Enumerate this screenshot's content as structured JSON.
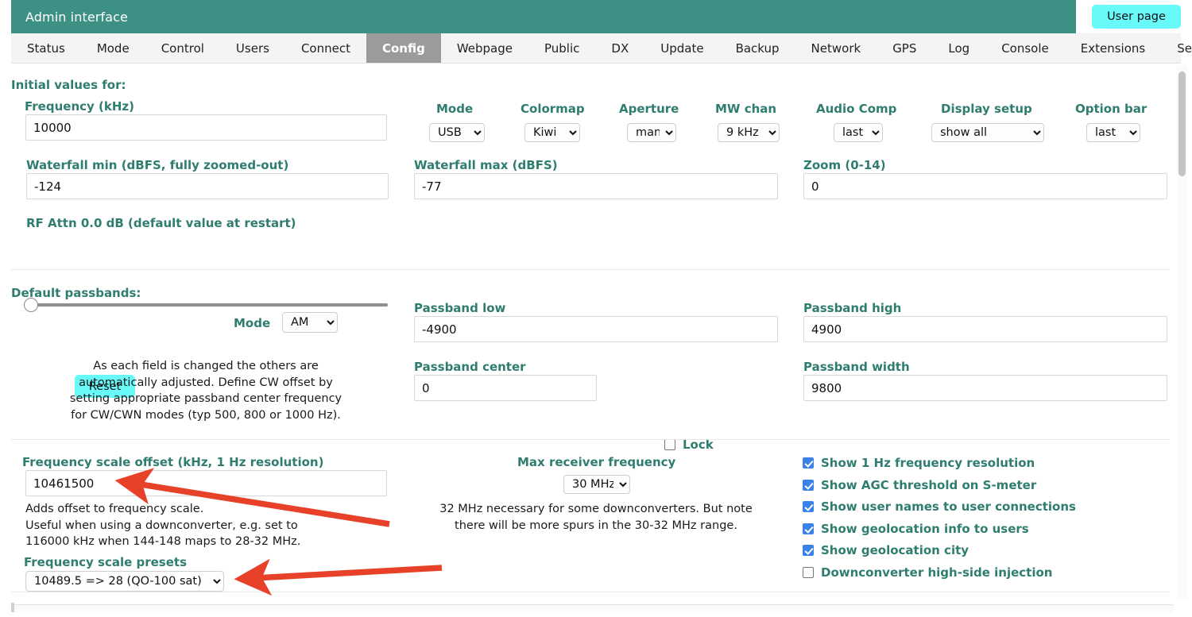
{
  "titlebar": {
    "title": "Admin interface",
    "user_page_button": "User page"
  },
  "tabs": [
    {
      "label": "Status",
      "active": false
    },
    {
      "label": "Mode",
      "active": false
    },
    {
      "label": "Control",
      "active": false
    },
    {
      "label": "Users",
      "active": false
    },
    {
      "label": "Connect",
      "active": false
    },
    {
      "label": "Config",
      "active": true
    },
    {
      "label": "Webpage",
      "active": false
    },
    {
      "label": "Public",
      "active": false
    },
    {
      "label": "DX",
      "active": false
    },
    {
      "label": "Update",
      "active": false
    },
    {
      "label": "Backup",
      "active": false
    },
    {
      "label": "Network",
      "active": false
    },
    {
      "label": "GPS",
      "active": false
    },
    {
      "label": "Log",
      "active": false
    },
    {
      "label": "Console",
      "active": false
    },
    {
      "label": "Extensions",
      "active": false
    },
    {
      "label": "Security",
      "active": false
    }
  ],
  "initial_values": {
    "heading": "Initial values for:",
    "frequency_label": "Frequency (kHz)",
    "frequency_value": "10000",
    "waterfall_min_label": "Waterfall min (dBFS, fully zoomed-out)",
    "waterfall_min_value": "-124",
    "rf_attn_label": "RF Attn 0.0 dB (default value at restart)",
    "mode_label": "Mode",
    "mode_value": "USB",
    "colormap_label": "Colormap",
    "colormap_value": "Kiwi",
    "aperture_label": "Aperture",
    "aperture_value": "man",
    "mw_chan_label": "MW chan",
    "mw_chan_value": "9 kHz",
    "audio_comp_label": "Audio Comp",
    "audio_comp_value": "last",
    "display_setup_label": "Display setup",
    "display_setup_value": "show all",
    "option_bar_label": "Option bar",
    "option_bar_value": "last",
    "waterfall_max_label": "Waterfall max (dBFS)",
    "waterfall_max_value": "-77",
    "zoom_label": "Zoom (0-14)",
    "zoom_value": "0"
  },
  "passbands": {
    "heading": "Default passbands:",
    "reset_button": "Reset",
    "mode_label": "Mode",
    "mode_value": "AM",
    "note_line1": "As each field is changed the others are",
    "note_line2": "automatically adjusted. Define CW offset by",
    "note_line3": "setting appropriate passband center frequency",
    "note_line4": "for CW/CWN modes (typ 500, 800 or 1000 Hz).",
    "passband_low_label": "Passband low",
    "passband_low_value": "-4900",
    "passband_high_label": "Passband high",
    "passband_high_value": "4900",
    "passband_center_label": "Passband center",
    "passband_center_value": "0",
    "lock_label": "Lock",
    "lock_checked": false,
    "passband_width_label": "Passband width",
    "passband_width_value": "9800"
  },
  "freq_scale": {
    "offset_label": "Frequency scale offset (kHz, 1 Hz resolution)",
    "offset_value": "10461500",
    "help_line1": "Adds offset to frequency scale.",
    "help_line2": "Useful when using a downconverter, e.g. set to",
    "help_line3": "116000 kHz when 144-148 maps to 28-32 MHz.",
    "presets_label": "Frequency scale presets",
    "presets_value": "10489.5 => 28 (QO-100 sat)",
    "max_rx_label": "Max receiver frequency",
    "max_rx_value": "30 MHz",
    "max_rx_note_line1": "32 MHz necessary for some downconverters. But note",
    "max_rx_note_line2": "there will be more spurs in the 30-32 MHz range."
  },
  "checkboxes": [
    {
      "label": "Show 1 Hz frequency resolution",
      "checked": true
    },
    {
      "label": "Show AGC threshold on S-meter",
      "checked": true
    },
    {
      "label": "Show user names to user connections",
      "checked": true
    },
    {
      "label": "Show geolocation info to users",
      "checked": true
    },
    {
      "label": "Show geolocation city",
      "checked": true
    },
    {
      "label": "Downconverter high-side injection",
      "checked": false
    }
  ],
  "annotations": {
    "arrow_color": "#e8412a",
    "arrow1_target": "frequency-scale-offset-input",
    "arrow2_target": "frequency-scale-presets-select"
  },
  "colors": {
    "header_teal": "#3d9184",
    "label_teal": "#2f7d6f",
    "button_cyan": "#68f9f9",
    "active_tab_gray": "#9b9b9b",
    "checkbox_blue": "#3b82e8"
  }
}
